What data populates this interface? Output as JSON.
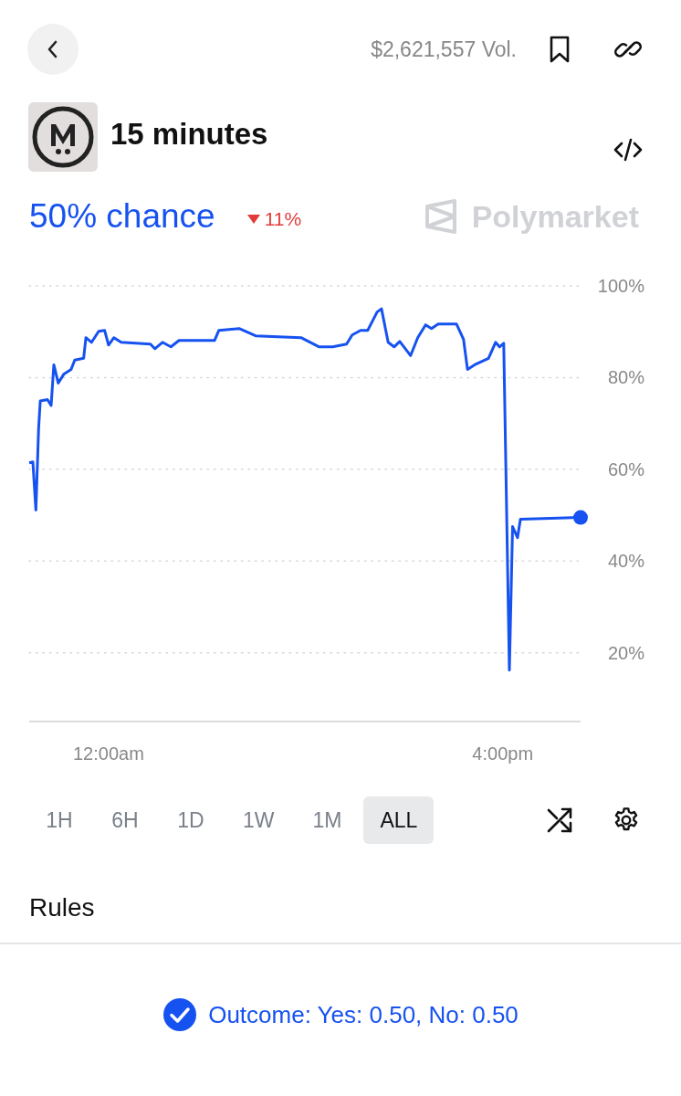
{
  "header": {
    "volume": "$2,621,557 Vol."
  },
  "market": {
    "title": "15 minutes"
  },
  "chance": {
    "text": "50% chance",
    "change": "11%",
    "falling": true
  },
  "brand": "Polymarket",
  "chart_data": {
    "type": "line",
    "grid": true,
    "xlim": [
      -3.22,
      19.16
    ],
    "ylim": [
      5,
      100
    ],
    "xticks": [
      {
        "value": 0,
        "label": "12:00am"
      },
      {
        "value": 16,
        "label": "4:00pm"
      }
    ],
    "yticks": [
      {
        "value": 20,
        "label": "20%"
      },
      {
        "value": 40,
        "label": "40%"
      },
      {
        "value": 60,
        "label": "60%"
      },
      {
        "value": 80,
        "label": "80%"
      },
      {
        "value": 100,
        "label": "100%"
      }
    ],
    "x": [
      -3.22,
      -3.07,
      -2.95,
      -2.84,
      -2.77,
      -2.48,
      -2.33,
      -2.22,
      -2.04,
      -1.81,
      -1.52,
      -1.37,
      -1.01,
      -0.92,
      -0.69,
      -0.4,
      -0.16,
      0,
      0.22,
      0.51,
      1.7,
      1.88,
      2.19,
      2.53,
      2.86,
      4.3,
      4.48,
      5.3,
      5.97,
      7.81,
      8.55,
      9.1,
      9.66,
      9.89,
      10.23,
      10.52,
      10.9,
      11.08,
      11.35,
      11.59,
      11.82,
      12.26,
      12.55,
      12.87,
      13.11,
      13.38,
      14.12,
      14.41,
      14.57,
      14.86,
      15.42,
      15.71,
      15.87,
      16.04,
      16.27,
      16.4,
      16.6,
      16.72,
      19.16
    ],
    "series": [
      {
        "color": "#1652f0",
        "values": [
          61.4,
          61.6,
          51.1,
          68.9,
          74.9,
          75.2,
          73.9,
          82.8,
          78.8,
          80.8,
          81.8,
          83.8,
          84.2,
          88.7,
          87.7,
          90.1,
          90.3,
          87.1,
          88.7,
          87.7,
          87.3,
          86.3,
          87.7,
          86.7,
          88.1,
          88.1,
          90.3,
          90.7,
          89.1,
          88.7,
          86.7,
          86.7,
          87.3,
          89.3,
          90.3,
          90.3,
          94.3,
          95.0,
          87.7,
          86.7,
          87.9,
          84.8,
          88.7,
          91.5,
          90.7,
          91.7,
          91.7,
          88.3,
          81.8,
          82.8,
          84.2,
          87.7,
          86.7,
          87.5,
          16.2,
          47.5,
          45.1,
          49.1,
          49.5
        ]
      }
    ]
  },
  "ranges": [
    {
      "label": "1H",
      "selected": false
    },
    {
      "label": "6H",
      "selected": false
    },
    {
      "label": "1D",
      "selected": false
    },
    {
      "label": "1W",
      "selected": false
    },
    {
      "label": "1M",
      "selected": false
    },
    {
      "label": "ALL",
      "selected": true
    }
  ],
  "rules_title": "Rules",
  "outcome": {
    "text": "Outcome: Yes: 0.50, No: 0.50",
    "resolved": true
  }
}
